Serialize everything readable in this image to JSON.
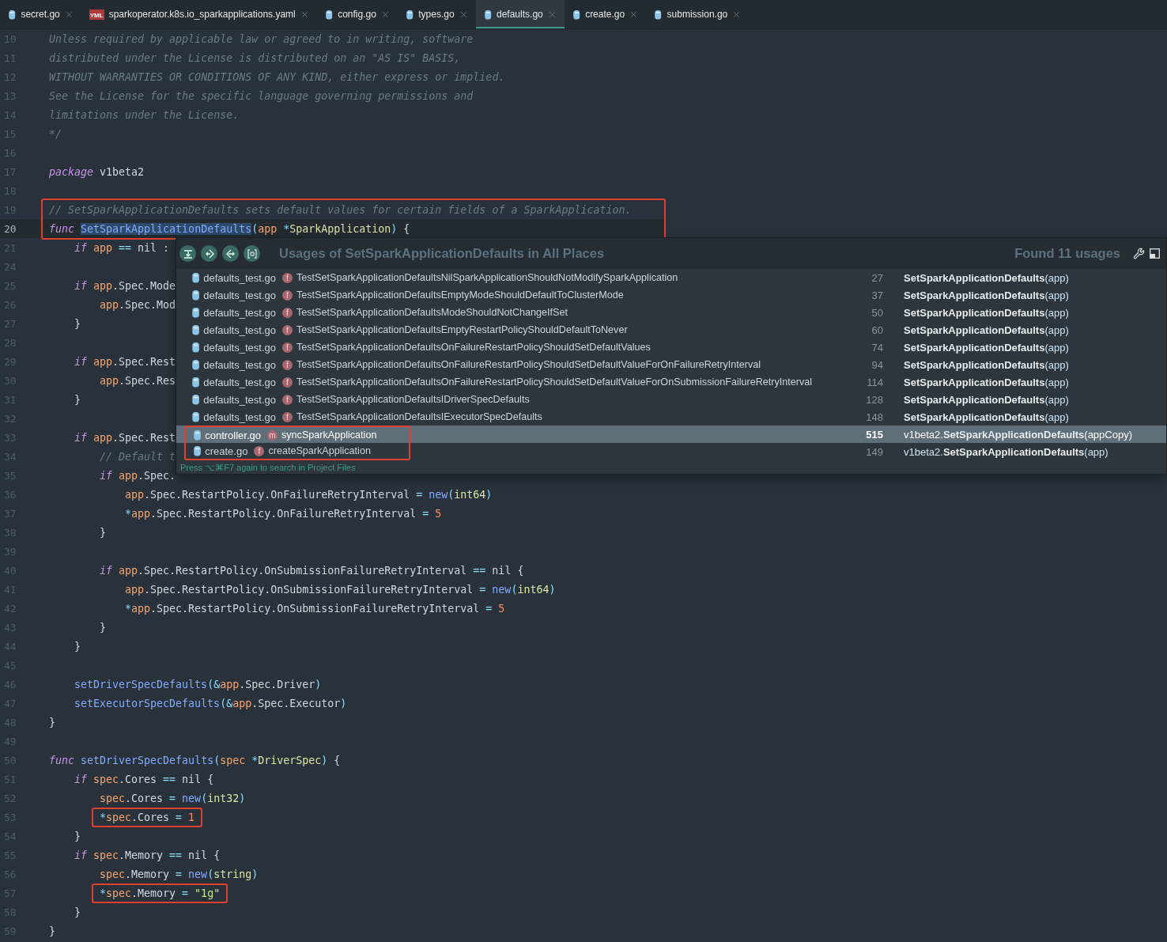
{
  "tabs": [
    {
      "label": "secret.go",
      "kind": "go",
      "selected": false
    },
    {
      "label": "sparkoperator.k8s.io_sparkapplications.yaml",
      "kind": "yaml",
      "icon_text": "YML",
      "selected": false
    },
    {
      "label": "config.go",
      "kind": "go",
      "selected": false
    },
    {
      "label": "types.go",
      "kind": "go",
      "selected": false
    },
    {
      "label": "defaults.go",
      "kind": "go",
      "selected": true
    },
    {
      "label": "create.go",
      "kind": "go",
      "selected": false
    },
    {
      "label": "submission.go",
      "kind": "go",
      "selected": false
    }
  ],
  "editor": {
    "lines": [
      {
        "kind": "line",
        "number": "10",
        "current": false,
        "tokens": [
          {
            "text": "Unless required by applicable law or agreed to in writing, software",
            "kind": "cm"
          }
        ]
      },
      {
        "kind": "line",
        "number": "11",
        "current": false,
        "tokens": [
          {
            "text": "distributed under the License is distributed on an \"AS IS\" BASIS,",
            "kind": "cm"
          }
        ]
      },
      {
        "kind": "line",
        "number": "12",
        "current": false,
        "tokens": [
          {
            "text": "WITHOUT WARRANTIES OR CONDITIONS OF ANY KIND, either express or implied.",
            "kind": "cm"
          }
        ]
      },
      {
        "kind": "line",
        "number": "13",
        "current": false,
        "tokens": [
          {
            "text": "See the License for the specific language governing permissions and",
            "kind": "cm"
          }
        ]
      },
      {
        "kind": "line",
        "number": "14",
        "current": false,
        "tokens": [
          {
            "text": "limitations under the License.",
            "kind": "cm"
          }
        ]
      },
      {
        "kind": "line",
        "number": "15",
        "current": false,
        "tokens": [
          {
            "text": "*/",
            "kind": "cm"
          }
        ]
      },
      {
        "kind": "line",
        "number": "16",
        "current": false
      },
      {
        "kind": "line",
        "number": "17",
        "current": false,
        "tokens": [
          {
            "text": "package",
            "kind": "kw"
          },
          {
            "text": " v1beta2",
            "kind": "pl"
          }
        ]
      },
      {
        "kind": "line",
        "number": "18",
        "current": false
      },
      {
        "kind": "box_group",
        "lines": [
          {
            "kind": "line",
            "number": "19",
            "current": false,
            "tokens": [
              {
                "text": "// SetSparkApplicationDefaults sets default values for certain fields of a SparkApplication.",
                "kind": "cm"
              }
            ]
          },
          {
            "kind": "line",
            "number": "20",
            "current": true,
            "tokens": [
              {
                "text": "func ",
                "kind": "kw"
              },
              {
                "text": "SetSparkApplicationDefaults",
                "kind": "sel"
              },
              {
                "text": "(",
                "kind": "op"
              },
              {
                "text": "app ",
                "kind": "var"
              },
              {
                "text": "*",
                "kind": "op"
              },
              {
                "text": "SparkApplication",
                "kind": "ty"
              },
              {
                "text": ")",
                "kind": "op"
              },
              {
                "text": " {",
                "kind": "pl"
              }
            ],
            "children": [
              {
                "kind": "line",
                "number": "21",
                "current": false,
                "tokens": [
                  {
                    "text": "if",
                    "kind": "kw"
                  },
                  {
                    "text": " app ",
                    "kind": "var"
                  },
                  {
                    "text": "==",
                    "kind": "op"
                  },
                  {
                    "text": " nil :",
                    "kind": "pl"
                  }
                ]
              },
              {
                "kind": "line",
                "number": "24",
                "current": false
              },
              {
                "kind": "line",
                "number": "25",
                "current": false,
                "tokens": [
                  {
                    "text": "if",
                    "kind": "kw"
                  },
                  {
                    "text": " app",
                    "kind": "var"
                  },
                  {
                    "text": ".Spec.Mode",
                    "kind": "pl"
                  }
                ],
                "children": [
                  {
                    "kind": "line",
                    "number": "26",
                    "current": false,
                    "tokens": [
                      {
                        "text": "app",
                        "kind": "var"
                      },
                      {
                        "text": ".Spec.Mod",
                        "kind": "pl"
                      }
                    ]
                  }
                ]
              },
              {
                "kind": "line",
                "number": "27",
                "current": false,
                "tokens": [
                  {
                    "text": "}",
                    "kind": "pl"
                  }
                ]
              },
              {
                "kind": "line",
                "number": "28",
                "current": false
              },
              {
                "kind": "line",
                "number": "29",
                "current": false,
                "tokens": [
                  {
                    "text": "if",
                    "kind": "kw"
                  },
                  {
                    "text": " app",
                    "kind": "var"
                  },
                  {
                    "text": ".Spec.Rest",
                    "kind": "pl"
                  }
                ],
                "children": [
                  {
                    "kind": "line",
                    "number": "30",
                    "current": false,
                    "tokens": [
                      {
                        "text": "app",
                        "kind": "var"
                      },
                      {
                        "text": ".Spec.Res",
                        "kind": "pl"
                      }
                    ]
                  }
                ]
              },
              {
                "kind": "line",
                "number": "31",
                "current": false,
                "tokens": [
                  {
                    "text": "}",
                    "kind": "pl"
                  }
                ]
              },
              {
                "kind": "line",
                "number": "32",
                "current": false
              },
              {
                "kind": "line",
                "number": "33",
                "current": false,
                "tokens": [
                  {
                    "text": "if",
                    "kind": "kw"
                  },
                  {
                    "text": " app",
                    "kind": "var"
                  },
                  {
                    "text": ".Spec.Rest",
                    "kind": "pl"
                  }
                ],
                "children": [
                  {
                    "kind": "line",
                    "number": "34",
                    "current": false,
                    "tokens": [
                      {
                        "text": "// Default t",
                        "kind": "cm"
                      }
                    ]
                  },
                  {
                    "kind": "line",
                    "number": "35",
                    "current": false,
                    "tokens": [
                      {
                        "text": "if",
                        "kind": "kw"
                      },
                      {
                        "text": " app",
                        "kind": "var"
                      },
                      {
                        "text": ".Spec.",
                        "kind": "pl"
                      }
                    ],
                    "children": [
                      {
                        "kind": "line",
                        "number": "36",
                        "current": false,
                        "tokens": [
                          {
                            "text": "app",
                            "kind": "var"
                          },
                          {
                            "text": ".Spec.RestartPolicy.OnFailureRetryInterval ",
                            "kind": "pl"
                          },
                          {
                            "text": "=",
                            "kind": "op"
                          },
                          {
                            "text": " new",
                            "kind": "fn"
                          },
                          {
                            "text": "(",
                            "kind": "op"
                          },
                          {
                            "text": "int64",
                            "kind": "ty"
                          },
                          {
                            "text": ")",
                            "kind": "op"
                          }
                        ]
                      },
                      {
                        "kind": "line",
                        "number": "37",
                        "current": false,
                        "tokens": [
                          {
                            "text": "*",
                            "kind": "op"
                          },
                          {
                            "text": "app",
                            "kind": "var"
                          },
                          {
                            "text": ".Spec.RestartPolicy.OnFailureRetryInterval ",
                            "kind": "pl"
                          },
                          {
                            "text": "=",
                            "kind": "op"
                          },
                          {
                            "text": " 5",
                            "kind": "num"
                          }
                        ]
                      }
                    ]
                  },
                  {
                    "kind": "line",
                    "number": "38",
                    "current": false,
                    "tokens": [
                      {
                        "text": "}",
                        "kind": "pl"
                      }
                    ]
                  },
                  {
                    "kind": "line",
                    "number": "39",
                    "current": false
                  },
                  {
                    "kind": "line",
                    "number": "40",
                    "current": false,
                    "tokens": [
                      {
                        "text": "if",
                        "kind": "kw"
                      },
                      {
                        "text": " app",
                        "kind": "var"
                      },
                      {
                        "text": ".Spec.RestartPolicy.OnSubmissionFailureRetryInterval ",
                        "kind": "pl"
                      },
                      {
                        "text": "==",
                        "kind": "op"
                      },
                      {
                        "text": " nil {",
                        "kind": "pl"
                      }
                    ],
                    "children": [
                      {
                        "kind": "line",
                        "number": "41",
                        "current": false,
                        "tokens": [
                          {
                            "text": "app",
                            "kind": "var"
                          },
                          {
                            "text": ".Spec.RestartPolicy.OnSubmissionFailureRetryInterval ",
                            "kind": "pl"
                          },
                          {
                            "text": "=",
                            "kind": "op"
                          },
                          {
                            "text": " new",
                            "kind": "fn"
                          },
                          {
                            "text": "(",
                            "kind": "op"
                          },
                          {
                            "text": "int64",
                            "kind": "ty"
                          },
                          {
                            "text": ")",
                            "kind": "op"
                          }
                        ]
                      },
                      {
                        "kind": "line",
                        "number": "42",
                        "current": false,
                        "tokens": [
                          {
                            "text": "*",
                            "kind": "op"
                          },
                          {
                            "text": "app",
                            "kind": "var"
                          },
                          {
                            "text": ".Spec.RestartPolicy.OnSubmissionFailureRetryInterval ",
                            "kind": "pl"
                          },
                          {
                            "text": "=",
                            "kind": "op"
                          },
                          {
                            "text": " 5",
                            "kind": "num"
                          }
                        ]
                      }
                    ]
                  },
                  {
                    "kind": "line",
                    "number": "43",
                    "current": false,
                    "tokens": [
                      {
                        "text": "}",
                        "kind": "pl"
                      }
                    ]
                  }
                ]
              },
              {
                "kind": "line",
                "number": "44",
                "current": false,
                "tokens": [
                  {
                    "text": "}",
                    "kind": "pl"
                  }
                ]
              },
              {
                "kind": "line",
                "number": "45",
                "current": false
              },
              {
                "kind": "line",
                "number": "46",
                "current": false,
                "tokens": [
                  {
                    "text": "setDriverSpecDefaults",
                    "kind": "fn"
                  },
                  {
                    "text": "(&",
                    "kind": "op"
                  },
                  {
                    "text": "app",
                    "kind": "var"
                  },
                  {
                    "text": ".Spec.Driver",
                    "kind": "pl"
                  },
                  {
                    "text": ")",
                    "kind": "op"
                  }
                ]
              },
              {
                "kind": "line",
                "number": "47",
                "current": false,
                "tokens": [
                  {
                    "text": "setExecutorSpecDefaults",
                    "kind": "fn"
                  },
                  {
                    "text": "(&",
                    "kind": "op"
                  },
                  {
                    "text": "app",
                    "kind": "var"
                  },
                  {
                    "text": ".Spec.Executor",
                    "kind": "pl"
                  },
                  {
                    "text": ")",
                    "kind": "op"
                  }
                ]
              }
            ]
          }
        ]
      },
      {
        "kind": "line",
        "number": "48",
        "current": false,
        "tokens": [
          {
            "text": "}",
            "kind": "pl"
          }
        ]
      },
      {
        "kind": "line",
        "number": "49",
        "current": false
      },
      {
        "kind": "line",
        "number": "50",
        "current": false,
        "tokens": [
          {
            "text": "func ",
            "kind": "kw"
          },
          {
            "text": "setDriverSpecDefaults",
            "kind": "fn"
          },
          {
            "text": "(",
            "kind": "op"
          },
          {
            "text": "spec ",
            "kind": "var"
          },
          {
            "text": "*",
            "kind": "op"
          },
          {
            "text": "DriverSpec",
            "kind": "ty"
          },
          {
            "text": ")",
            "kind": "op"
          },
          {
            "text": " {",
            "kind": "pl"
          }
        ],
        "children": [
          {
            "kind": "line",
            "number": "51",
            "current": false,
            "tokens": [
              {
                "text": "if",
                "kind": "kw"
              },
              {
                "text": " spec",
                "kind": "var"
              },
              {
                "text": ".Cores ",
                "kind": "pl"
              },
              {
                "text": "==",
                "kind": "op"
              },
              {
                "text": " nil {",
                "kind": "pl"
              }
            ],
            "children": [
              {
                "kind": "line",
                "number": "52",
                "current": false,
                "tokens": [
                  {
                    "text": "spec",
                    "kind": "var"
                  },
                  {
                    "text": ".Cores ",
                    "kind": "pl"
                  },
                  {
                    "text": "=",
                    "kind": "op"
                  },
                  {
                    "text": " new",
                    "kind": "fn"
                  },
                  {
                    "text": "(",
                    "kind": "op"
                  },
                  {
                    "text": "int32",
                    "kind": "ty"
                  },
                  {
                    "text": ")",
                    "kind": "op"
                  }
                ]
              },
              {
                "kind": "boxed_line",
                "number": "53",
                "current": false,
                "tokens": [
                  {
                    "text": "*",
                    "kind": "op"
                  },
                  {
                    "text": "spec",
                    "kind": "var"
                  },
                  {
                    "text": ".Cores ",
                    "kind": "pl"
                  },
                  {
                    "text": "=",
                    "kind": "op"
                  },
                  {
                    "text": " 1",
                    "kind": "num"
                  }
                ]
              }
            ]
          },
          {
            "kind": "line",
            "number": "54",
            "current": false,
            "tokens": [
              {
                "text": "}",
                "kind": "pl"
              }
            ]
          },
          {
            "kind": "line",
            "number": "55",
            "current": false,
            "tokens": [
              {
                "text": "if",
                "kind": "kw"
              },
              {
                "text": " spec",
                "kind": "var"
              },
              {
                "text": ".Memory ",
                "kind": "pl"
              },
              {
                "text": "==",
                "kind": "op"
              },
              {
                "text": " nil {",
                "kind": "pl"
              }
            ],
            "children": [
              {
                "kind": "line",
                "number": "56",
                "current": false,
                "tokens": [
                  {
                    "text": "spec",
                    "kind": "var"
                  },
                  {
                    "text": ".Memory ",
                    "kind": "pl"
                  },
                  {
                    "text": "=",
                    "kind": "op"
                  },
                  {
                    "text": " new",
                    "kind": "fn"
                  },
                  {
                    "text": "(",
                    "kind": "op"
                  },
                  {
                    "text": "string",
                    "kind": "ty"
                  },
                  {
                    "text": ")",
                    "kind": "op"
                  }
                ]
              },
              {
                "kind": "boxed_line",
                "number": "57",
                "current": false,
                "tokens": [
                  {
                    "text": "*",
                    "kind": "op"
                  },
                  {
                    "text": "spec",
                    "kind": "var"
                  },
                  {
                    "text": ".Memory ",
                    "kind": "pl"
                  },
                  {
                    "text": "=",
                    "kind": "op"
                  },
                  {
                    "text": " \"1g\"",
                    "kind": "str"
                  }
                ]
              }
            ]
          },
          {
            "kind": "line",
            "number": "58",
            "current": false,
            "tokens": [
              {
                "text": "}",
                "kind": "pl"
              }
            ]
          }
        ]
      },
      {
        "kind": "line",
        "number": "59",
        "current": false,
        "tokens": [
          {
            "text": "}",
            "kind": "pl"
          }
        ]
      }
    ]
  },
  "usages_popup": {
    "title": "Usages of SetSparkApplicationDefaults in All Places",
    "count": "Found 11 usages",
    "rows": [
      {
        "file": "defaults_test.go",
        "badge": "f",
        "function": "TestSetSparkApplicationDefaultsNilSparkApplicationShouldNotModifySparkApplication",
        "line": "27",
        "call": "**SetSparkApplicationDefaults**(app)",
        "boxed": false,
        "selected": false
      },
      {
        "file": "defaults_test.go",
        "badge": "f",
        "function": "TestSetSparkApplicationDefaultsEmptyModeShouldDefaultToClusterMode",
        "line": "37",
        "call": "**SetSparkApplicationDefaults**(app)",
        "boxed": false,
        "selected": false
      },
      {
        "file": "defaults_test.go",
        "badge": "f",
        "function": "TestSetSparkApplicationDefaultsModeShouldNotChangeIfSet",
        "line": "50",
        "call": "**SetSparkApplicationDefaults**(app)",
        "boxed": false,
        "selected": false
      },
      {
        "file": "defaults_test.go",
        "badge": "f",
        "function": "TestSetSparkApplicationDefaultsEmptyRestartPolicyShouldDefaultToNever",
        "line": "60",
        "call": "**SetSparkApplicationDefaults**(app)",
        "boxed": false,
        "selected": false
      },
      {
        "file": "defaults_test.go",
        "badge": "f",
        "function": "TestSetSparkApplicationDefaultsOnFailureRestartPolicyShouldSetDefaultValues",
        "line": "74",
        "call": "**SetSparkApplicationDefaults**(app)",
        "boxed": false,
        "selected": false
      },
      {
        "file": "defaults_test.go",
        "badge": "f",
        "function": "TestSetSparkApplicationDefaultsOnFailureRestartPolicyShouldSetDefaultValueForOnFailureRetryInterval",
        "line": "94",
        "call": "**SetSparkApplicationDefaults**(app)",
        "boxed": false,
        "selected": false
      },
      {
        "file": "defaults_test.go",
        "badge": "f",
        "function": "TestSetSparkApplicationDefaultsOnFailureRestartPolicyShouldSetDefaultValueForOnSubmissionFailureRetryInterval",
        "line": "114",
        "call": "**SetSparkApplicationDefaults**(app)",
        "boxed": false,
        "selected": false
      },
      {
        "file": "defaults_test.go",
        "badge": "f",
        "function": "TestSetSparkApplicationDefaultsIDriverSpecDefaults",
        "line": "128",
        "call": "**SetSparkApplicationDefaults**(app)",
        "boxed": false,
        "selected": false
      },
      {
        "file": "defaults_test.go",
        "badge": "f",
        "function": "TestSetSparkApplicationDefaultsIExecutorSpecDefaults",
        "line": "148",
        "call": "**SetSparkApplicationDefaults**(app)",
        "boxed": false,
        "selected": false
      },
      {
        "file": "controller.go",
        "badge": "m",
        "function": "syncSparkApplication",
        "line": "515",
        "call": "v1beta2.**SetSparkApplicationDefaults**(appCopy)",
        "boxed": true,
        "selected": true
      },
      {
        "file": "create.go",
        "badge": "f",
        "function": "createSparkApplication",
        "line": "149",
        "call": "v1beta2.**SetSparkApplicationDefaults**(app)",
        "boxed": true,
        "selected": false
      }
    ],
    "hint": "Press ⌥⌘F7 again to search in Project Files"
  }
}
